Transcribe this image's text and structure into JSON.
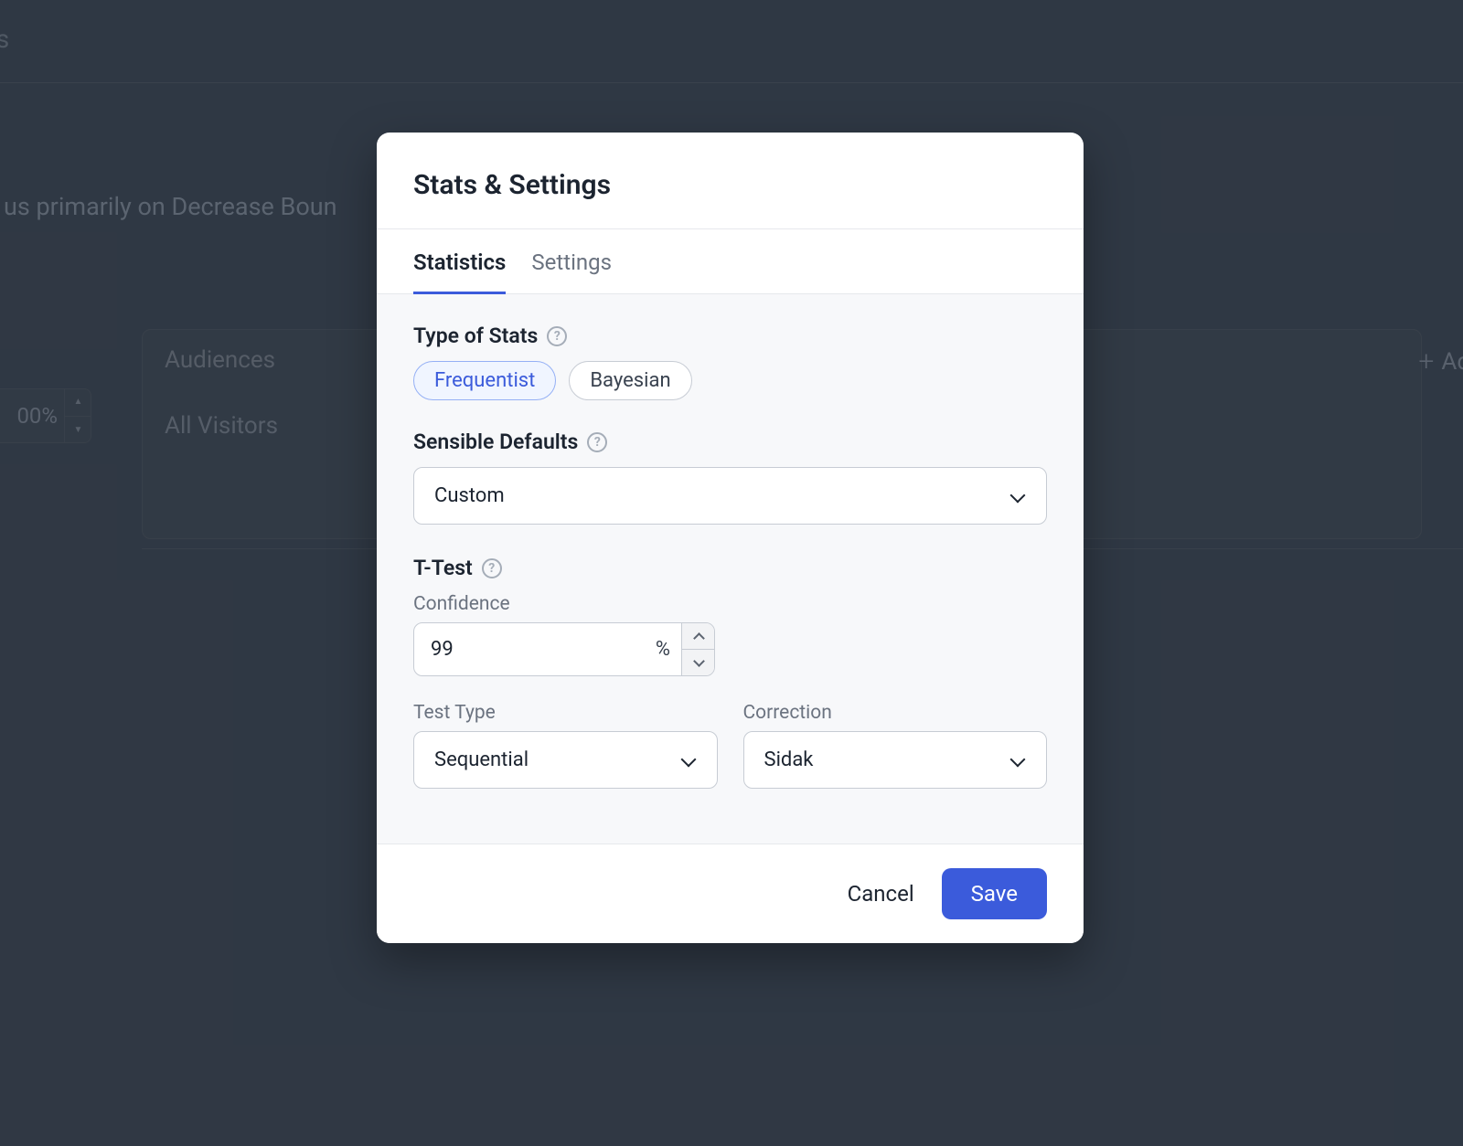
{
  "background": {
    "title_fragment": "gs",
    "description_fragment": "us primarily on Decrease Boun",
    "audiences_label": "Audiences",
    "audiences_value": "All Visitors",
    "percent_value": "00%",
    "add_label": "Ad"
  },
  "modal": {
    "title": "Stats & Settings",
    "tabs": [
      {
        "id": "statistics",
        "label": "Statistics",
        "active": true
      },
      {
        "id": "settings",
        "label": "Settings",
        "active": false
      }
    ],
    "type_of_stats": {
      "label": "Type of Stats",
      "options": [
        {
          "id": "frequentist",
          "label": "Frequentist",
          "selected": true
        },
        {
          "id": "bayesian",
          "label": "Bayesian",
          "selected": false
        }
      ]
    },
    "sensible_defaults": {
      "label": "Sensible Defaults",
      "value": "Custom"
    },
    "t_test": {
      "label": "T-Test",
      "confidence": {
        "label": "Confidence",
        "value": "99",
        "unit": "%"
      },
      "test_type": {
        "label": "Test Type",
        "value": "Sequential"
      },
      "correction": {
        "label": "Correction",
        "value": "Sidak"
      }
    },
    "actions": {
      "cancel": "Cancel",
      "save": "Save"
    }
  }
}
